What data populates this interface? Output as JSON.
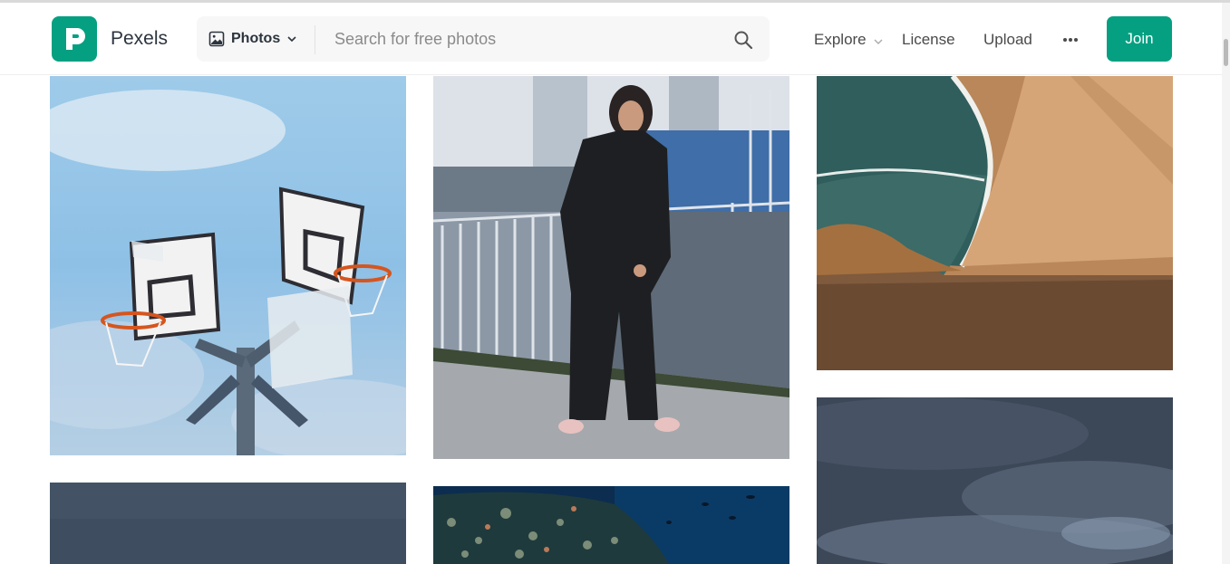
{
  "header": {
    "brand": "Pexels",
    "logo_letter": "P",
    "search": {
      "media_type": "Photos",
      "placeholder": "Search for free photos",
      "value": ""
    },
    "nav": {
      "explore": "Explore",
      "license": "License",
      "upload": "Upload"
    },
    "join_label": "Join"
  },
  "icons": {
    "logo": "pexels-logo-icon",
    "media": "image-icon",
    "dropdown": "chevron-down-icon",
    "search": "search-icon",
    "more": "more-horizontal-icon"
  },
  "colors": {
    "brand": "#05a081",
    "text": "#2c343e",
    "search_bg": "#f7f7f7"
  },
  "gallery": {
    "columns": [
      {
        "photos": [
          "basketball-hoops-photo",
          "dark-blue-photo"
        ]
      },
      {
        "photos": [
          "woman-in-black-suit-photo",
          "underwater-reef-photo"
        ]
      },
      {
        "photos": [
          "beach-coastline-photo",
          "cloudy-sky-photo"
        ]
      }
    ]
  }
}
